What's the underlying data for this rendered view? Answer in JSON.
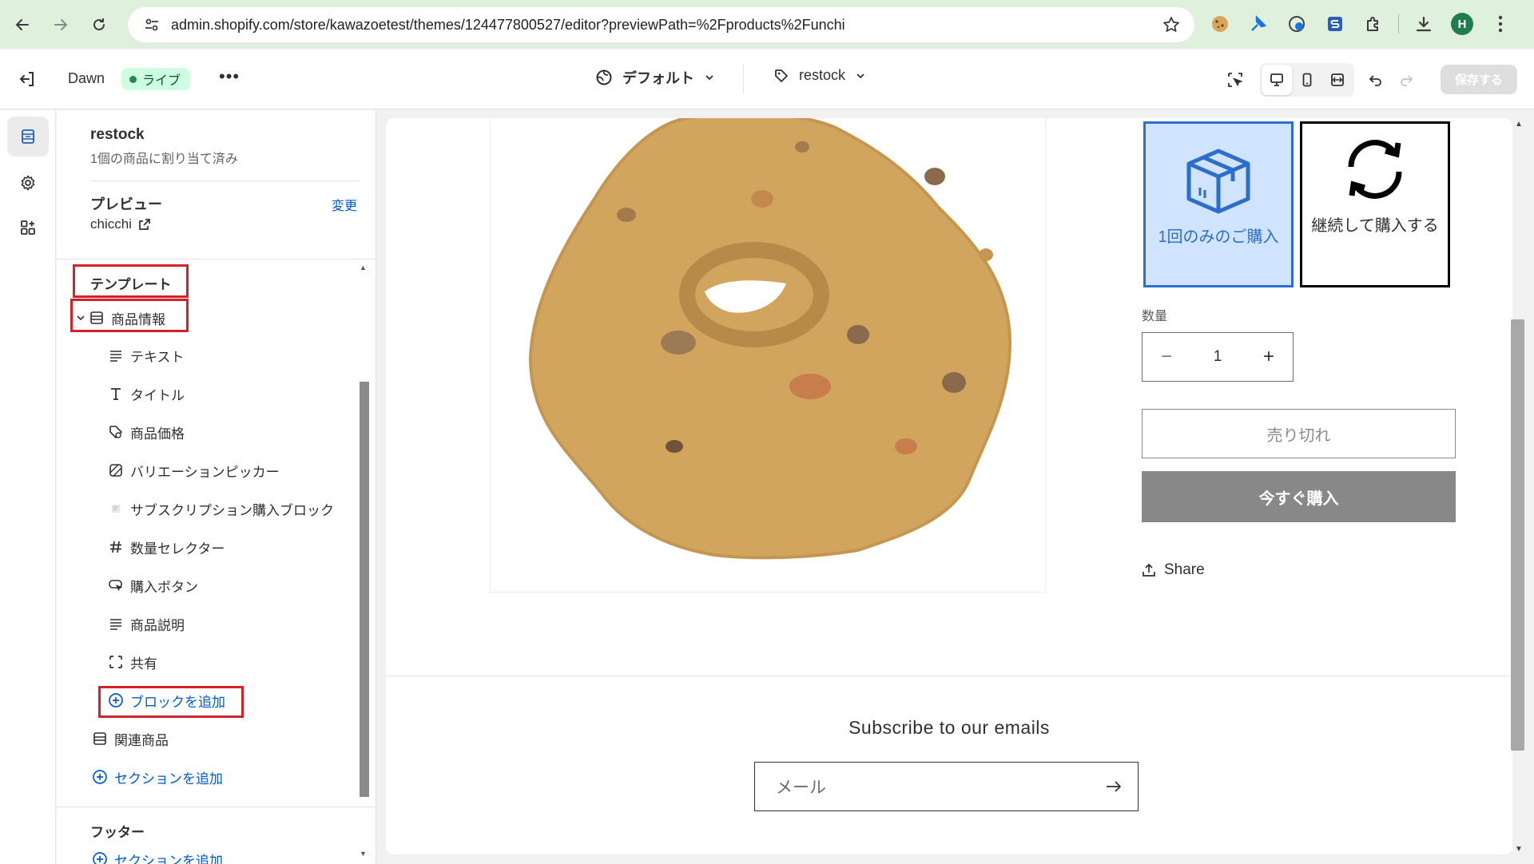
{
  "browser": {
    "url": "admin.shopify.com/store/kawazoetest/themes/124477800527/editor?previewPath=%2Fproducts%2Funchi",
    "profile_initial": "H"
  },
  "topbar": {
    "theme_name": "Dawn",
    "live_badge": "ライブ",
    "more": "•••",
    "language": "デフォルト",
    "template": "restock",
    "save_label": "保存する"
  },
  "sidebar": {
    "template_title": "restock",
    "template_subtitle": "1個の商品に割り当て済み",
    "preview_label": "プレビュー",
    "change_link": "変更",
    "preview_value": "chicchi",
    "template_heading": "テンプレート",
    "section_name": "商品情報",
    "blocks": [
      {
        "label": "テキスト",
        "icon": "text-lines-icon"
      },
      {
        "label": "タイトル",
        "icon": "title-t-icon"
      },
      {
        "label": "商品価格",
        "icon": "price-tag-icon"
      },
      {
        "label": "バリエーションピッカー",
        "icon": "variant-picker-icon"
      },
      {
        "label": "サブスクリプション購入ブロック",
        "icon": "app-block-icon"
      },
      {
        "label": "数量セレクター",
        "icon": "hash-icon"
      },
      {
        "label": "購入ボタン",
        "icon": "buy-button-icon"
      },
      {
        "label": "商品説明",
        "icon": "text-lines-icon"
      },
      {
        "label": "共有",
        "icon": "share-frame-icon"
      }
    ],
    "add_block": "ブロックを追加",
    "related_products": "関連商品",
    "add_section": "セクションを追加",
    "footer_heading": "フッター",
    "footer_add_section": "セクションを追加"
  },
  "preview": {
    "purchase_options": [
      {
        "label": "1回のみのご購入",
        "selected": true
      },
      {
        "label": "継続して購入する",
        "selected": false
      }
    ],
    "quantity_label": "数量",
    "quantity_value": "1",
    "sold_out_label": "売り切れ",
    "buy_now_label": "今すぐ購入",
    "share_label": "Share",
    "subscribe_heading": "Subscribe to our emails",
    "email_placeholder": "メール"
  },
  "colors": {
    "highlight_box": "#d6202a",
    "link_blue": "#005bd3",
    "selected_option_bg": "#d0e3ff",
    "selected_option_border": "#2c6ecb",
    "buy_now_bg": "#888888",
    "live_badge_bg": "#cdfee1"
  }
}
